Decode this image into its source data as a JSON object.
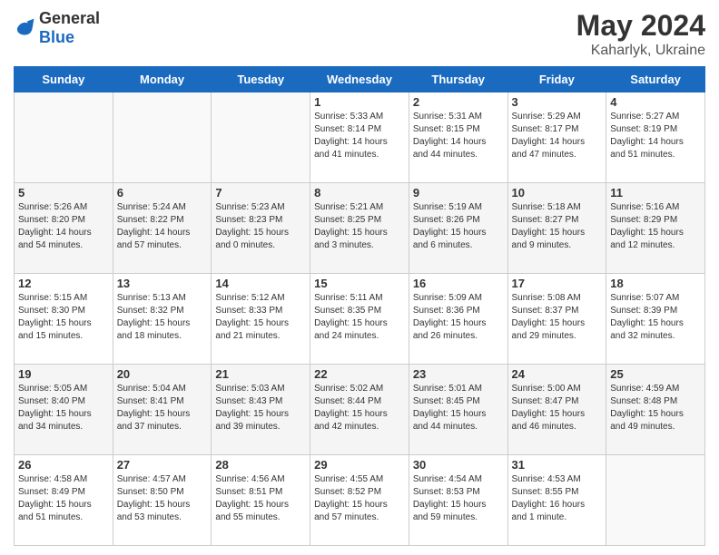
{
  "header": {
    "logo_general": "General",
    "logo_blue": "Blue",
    "month": "May 2024",
    "location": "Kaharlyk, Ukraine"
  },
  "weekdays": [
    "Sunday",
    "Monday",
    "Tuesday",
    "Wednesday",
    "Thursday",
    "Friday",
    "Saturday"
  ],
  "weeks": [
    [
      {
        "day": "",
        "info": ""
      },
      {
        "day": "",
        "info": ""
      },
      {
        "day": "",
        "info": ""
      },
      {
        "day": "1",
        "info": "Sunrise: 5:33 AM\nSunset: 8:14 PM\nDaylight: 14 hours\nand 41 minutes."
      },
      {
        "day": "2",
        "info": "Sunrise: 5:31 AM\nSunset: 8:15 PM\nDaylight: 14 hours\nand 44 minutes."
      },
      {
        "day": "3",
        "info": "Sunrise: 5:29 AM\nSunset: 8:17 PM\nDaylight: 14 hours\nand 47 minutes."
      },
      {
        "day": "4",
        "info": "Sunrise: 5:27 AM\nSunset: 8:19 PM\nDaylight: 14 hours\nand 51 minutes."
      }
    ],
    [
      {
        "day": "5",
        "info": "Sunrise: 5:26 AM\nSunset: 8:20 PM\nDaylight: 14 hours\nand 54 minutes."
      },
      {
        "day": "6",
        "info": "Sunrise: 5:24 AM\nSunset: 8:22 PM\nDaylight: 14 hours\nand 57 minutes."
      },
      {
        "day": "7",
        "info": "Sunrise: 5:23 AM\nSunset: 8:23 PM\nDaylight: 15 hours\nand 0 minutes."
      },
      {
        "day": "8",
        "info": "Sunrise: 5:21 AM\nSunset: 8:25 PM\nDaylight: 15 hours\nand 3 minutes."
      },
      {
        "day": "9",
        "info": "Sunrise: 5:19 AM\nSunset: 8:26 PM\nDaylight: 15 hours\nand 6 minutes."
      },
      {
        "day": "10",
        "info": "Sunrise: 5:18 AM\nSunset: 8:27 PM\nDaylight: 15 hours\nand 9 minutes."
      },
      {
        "day": "11",
        "info": "Sunrise: 5:16 AM\nSunset: 8:29 PM\nDaylight: 15 hours\nand 12 minutes."
      }
    ],
    [
      {
        "day": "12",
        "info": "Sunrise: 5:15 AM\nSunset: 8:30 PM\nDaylight: 15 hours\nand 15 minutes."
      },
      {
        "day": "13",
        "info": "Sunrise: 5:13 AM\nSunset: 8:32 PM\nDaylight: 15 hours\nand 18 minutes."
      },
      {
        "day": "14",
        "info": "Sunrise: 5:12 AM\nSunset: 8:33 PM\nDaylight: 15 hours\nand 21 minutes."
      },
      {
        "day": "15",
        "info": "Sunrise: 5:11 AM\nSunset: 8:35 PM\nDaylight: 15 hours\nand 24 minutes."
      },
      {
        "day": "16",
        "info": "Sunrise: 5:09 AM\nSunset: 8:36 PM\nDaylight: 15 hours\nand 26 minutes."
      },
      {
        "day": "17",
        "info": "Sunrise: 5:08 AM\nSunset: 8:37 PM\nDaylight: 15 hours\nand 29 minutes."
      },
      {
        "day": "18",
        "info": "Sunrise: 5:07 AM\nSunset: 8:39 PM\nDaylight: 15 hours\nand 32 minutes."
      }
    ],
    [
      {
        "day": "19",
        "info": "Sunrise: 5:05 AM\nSunset: 8:40 PM\nDaylight: 15 hours\nand 34 minutes."
      },
      {
        "day": "20",
        "info": "Sunrise: 5:04 AM\nSunset: 8:41 PM\nDaylight: 15 hours\nand 37 minutes."
      },
      {
        "day": "21",
        "info": "Sunrise: 5:03 AM\nSunset: 8:43 PM\nDaylight: 15 hours\nand 39 minutes."
      },
      {
        "day": "22",
        "info": "Sunrise: 5:02 AM\nSunset: 8:44 PM\nDaylight: 15 hours\nand 42 minutes."
      },
      {
        "day": "23",
        "info": "Sunrise: 5:01 AM\nSunset: 8:45 PM\nDaylight: 15 hours\nand 44 minutes."
      },
      {
        "day": "24",
        "info": "Sunrise: 5:00 AM\nSunset: 8:47 PM\nDaylight: 15 hours\nand 46 minutes."
      },
      {
        "day": "25",
        "info": "Sunrise: 4:59 AM\nSunset: 8:48 PM\nDaylight: 15 hours\nand 49 minutes."
      }
    ],
    [
      {
        "day": "26",
        "info": "Sunrise: 4:58 AM\nSunset: 8:49 PM\nDaylight: 15 hours\nand 51 minutes."
      },
      {
        "day": "27",
        "info": "Sunrise: 4:57 AM\nSunset: 8:50 PM\nDaylight: 15 hours\nand 53 minutes."
      },
      {
        "day": "28",
        "info": "Sunrise: 4:56 AM\nSunset: 8:51 PM\nDaylight: 15 hours\nand 55 minutes."
      },
      {
        "day": "29",
        "info": "Sunrise: 4:55 AM\nSunset: 8:52 PM\nDaylight: 15 hours\nand 57 minutes."
      },
      {
        "day": "30",
        "info": "Sunrise: 4:54 AM\nSunset: 8:53 PM\nDaylight: 15 hours\nand 59 minutes."
      },
      {
        "day": "31",
        "info": "Sunrise: 4:53 AM\nSunset: 8:55 PM\nDaylight: 16 hours\nand 1 minute."
      },
      {
        "day": "",
        "info": ""
      }
    ]
  ]
}
